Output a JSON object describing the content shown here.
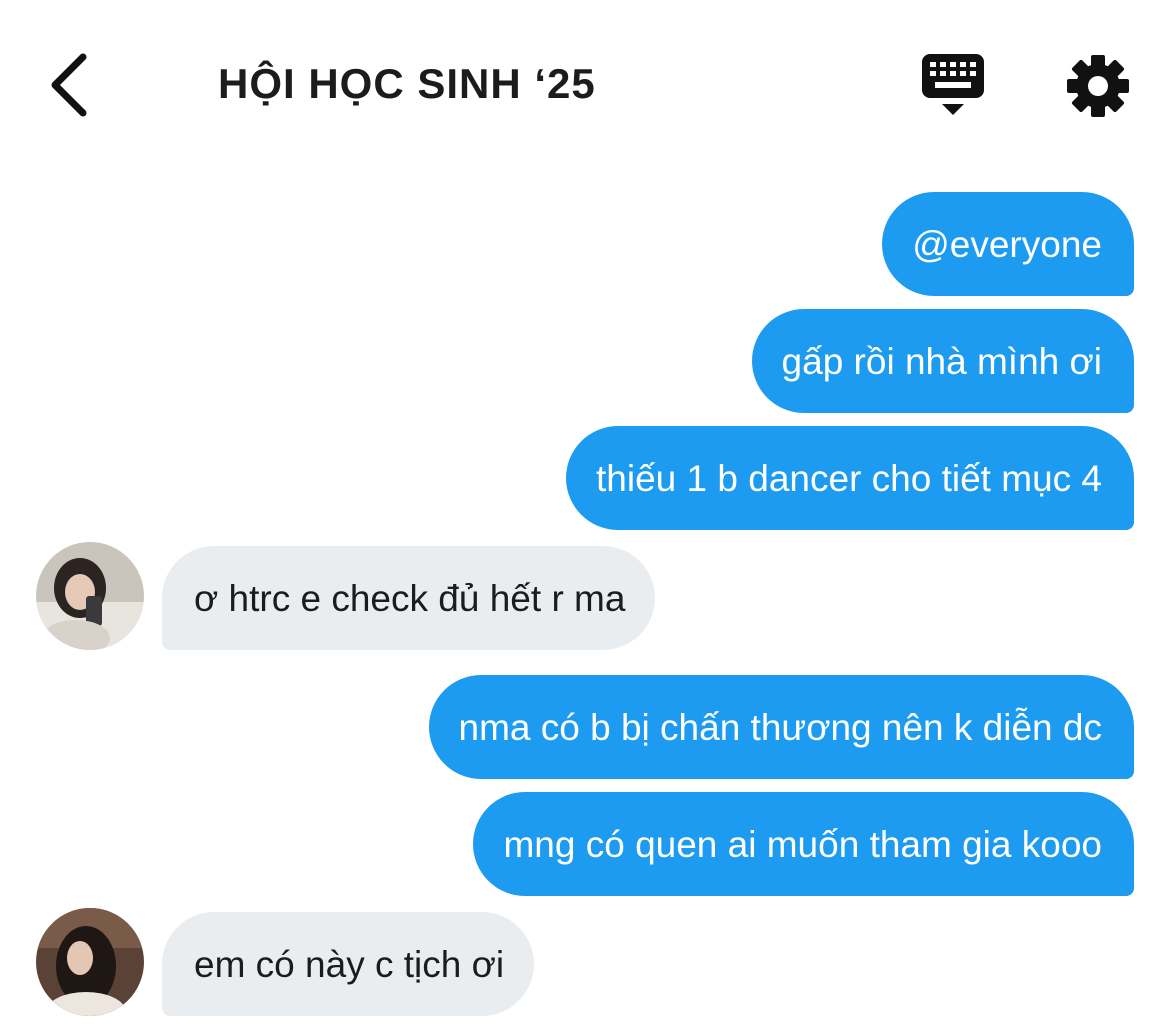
{
  "header": {
    "title": "HỘI HỌC SINH ‘25",
    "back_icon": "chevron-left-icon",
    "keyboard_icon": "keyboard-icon",
    "settings_icon": "gear-icon"
  },
  "colors": {
    "outgoing_bubble": "#1d9bf0",
    "incoming_bubble": "#eaedf0",
    "outgoing_text": "#ffffff",
    "incoming_text": "#1c1c1e"
  },
  "messages": [
    {
      "direction": "out",
      "text": "@everyone"
    },
    {
      "direction": "out",
      "text": "gấp rồi nhà mình ơi"
    },
    {
      "direction": "out",
      "text": "thiếu 1 b dancer cho tiết mục 4"
    },
    {
      "direction": "in",
      "text": "ơ htrc e check đủ hết r ma"
    },
    {
      "direction": "out",
      "text": "nma có b bị chấn thương nên k diễn dc"
    },
    {
      "direction": "out",
      "text": "mng có quen ai muốn tham gia kooo"
    },
    {
      "direction": "in",
      "text": "em có này c tịch ơi"
    }
  ]
}
